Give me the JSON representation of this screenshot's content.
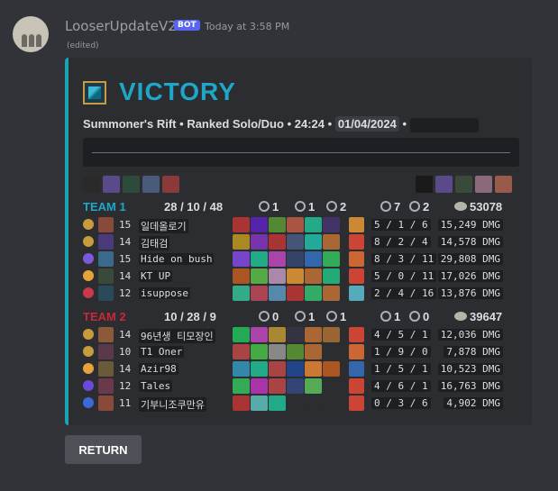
{
  "message": {
    "username": "LooserUpdateV2",
    "bot_badge": "BOT",
    "timestamp": "Today at 3:58 PM",
    "edited": "(edited)"
  },
  "embed": {
    "accent_color": "#1aa3b3",
    "result": "VICTORY",
    "map": "Summoner's Rift",
    "queue": "Ranked Solo/Duo",
    "duration": "24:24",
    "date": "01/04/2024",
    "separator": "•",
    "bans_left": [
      "#2a2a2a",
      "#5a4a8a",
      "#2d4a3a",
      "#4a5a7a",
      "#8a3a3a"
    ],
    "bans_right": [
      "#1a1a1a",
      "#5a4a8a",
      "#3a4a3a",
      "#8a6a7a",
      "#9a5a4a"
    ],
    "teams": [
      {
        "label": "TEAM 1",
        "kda": "28 / 10 / 48",
        "dragons": "1",
        "heralds": "1",
        "barons": "2",
        "towers": "7",
        "inhibs": "2",
        "gold": "53078",
        "players": [
          {
            "role_color": "#c89b3c",
            "champ_color": "#8a4a3a",
            "level": "15",
            "name": "일데올로기",
            "items": [
              "#a33",
              "#52a",
              "#583",
              "#a54",
              "#2a8",
              "#436"
            ],
            "trinket": "#c83",
            "kda": "5 / 1 / 6",
            "dmg": "15,249 DMG"
          },
          {
            "role_color": "#c89b3c",
            "champ_color": "#4a3a7a",
            "level": "14",
            "name": "김태검",
            "items": [
              "#a82",
              "#73a",
              "#a33",
              "#457",
              "#2a9",
              "#a63"
            ],
            "trinket": "#c43",
            "kda": "8 / 2 / 4",
            "dmg": "14,578 DMG"
          },
          {
            "role_color": "#7a5ad8",
            "champ_color": "#3a6a8a",
            "level": "15",
            "name": "Hide on bush",
            "items": [
              "#74c",
              "#2a8",
              "#a4a",
              "#346",
              "#36a",
              "#3a5"
            ],
            "trinket": "#c63",
            "kda": "8 / 3 / 11",
            "dmg": "29,808 DMG"
          },
          {
            "role_color": "#e8a23a",
            "champ_color": "#3a4a3a",
            "level": "14",
            "name": "KT UP",
            "items": [
              "#a52",
              "#5a4",
              "#a8a",
              "#c83",
              "#a63",
              "#2a7"
            ],
            "trinket": "#c43",
            "kda": "5 / 0 / 11",
            "dmg": "17,026 DMG"
          },
          {
            "role_color": "#c83a4a",
            "champ_color": "#2a4a5a",
            "level": "12",
            "name": "isuppose",
            "items": [
              "#3a8",
              "#a45",
              "#58a",
              "#a33",
              "#3a6",
              "#a63"
            ],
            "trinket": "#5ab",
            "kda": "2 / 4 / 16",
            "dmg": "13,876 DMG"
          }
        ]
      },
      {
        "label": "TEAM 2",
        "kda": "10 / 28 / 9",
        "dragons": "0",
        "heralds": "1",
        "barons": "1",
        "towers": "1",
        "inhibs": "0",
        "gold": "39647",
        "players": [
          {
            "role_color": "#c89b3c",
            "champ_color": "#8a5a3a",
            "level": "14",
            "name": "96년생 티모장인",
            "items": [
              "#2a5",
              "#a4a",
              "#a83",
              "#334",
              "#a63",
              "#963"
            ],
            "trinket": "#c43",
            "kda": "4 / 5 / 1",
            "dmg": "12,036 DMG"
          },
          {
            "role_color": "#c89b3c",
            "champ_color": "#5a3a4a",
            "level": "10",
            "name": "T1 Oner",
            "items": [
              "#a44",
              "#4a4",
              "#888",
              "#583",
              "#a63",
              "#2b2d31"
            ],
            "trinket": "#c63",
            "kda": "1 / 9 / 0",
            "dmg": "7,878 DMG"
          },
          {
            "role_color": "#e8a23a",
            "champ_color": "#6a5a3a",
            "level": "14",
            "name": "Azir98",
            "items": [
              "#38a",
              "#2a8",
              "#a44",
              "#248",
              "#c73",
              "#a52"
            ],
            "trinket": "#36a",
            "kda": "1 / 5 / 1",
            "dmg": "10,523 DMG"
          },
          {
            "role_color": "#6a4ad8",
            "champ_color": "#6a3a4a",
            "level": "12",
            "name": "Tales",
            "items": [
              "#3a5",
              "#a3a",
              "#a44",
              "#347",
              "#5a5",
              "#2b2d31"
            ],
            "trinket": "#c43",
            "kda": "4 / 6 / 1",
            "dmg": "16,763 DMG"
          },
          {
            "role_color": "#3a6ad8",
            "champ_color": "#8a4a3a",
            "level": "11",
            "name": "기부니조쿠만유",
            "items": [
              "#a33",
              "#5aa",
              "#2a8",
              "#2b2d31",
              "#2b2d31",
              "#2b2d31"
            ],
            "trinket": "#c43",
            "kda": "0 / 3 / 6",
            "dmg": "4,902 DMG"
          }
        ]
      }
    ]
  },
  "return_button": "RETURN"
}
